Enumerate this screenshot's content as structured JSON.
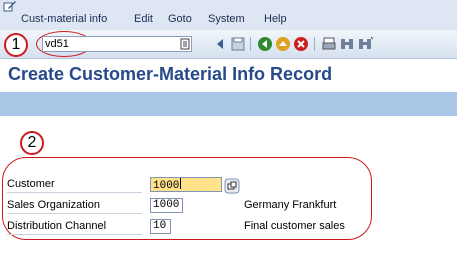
{
  "menu": {
    "items": [
      "Cust-material info",
      "Edit",
      "Goto",
      "System",
      "Help"
    ]
  },
  "toolbar": {
    "command_value": "vd51",
    "buttons": [
      "enter-icon",
      "save-icon",
      "back-icon",
      "exit-icon",
      "cancel-icon",
      "print-icon",
      "find-icon",
      "find-next-icon"
    ]
  },
  "annotations": {
    "step1": "1",
    "step2": "2"
  },
  "page": {
    "title": "Create Customer-Material Info Record"
  },
  "form": {
    "fields": [
      {
        "label": "Customer",
        "value": "1000",
        "description": ""
      },
      {
        "label": "Sales Organization",
        "value": "1000",
        "description": "Germany Frankfurt"
      },
      {
        "label": "Distribution Channel",
        "value": "10",
        "description": "Final customer sales"
      }
    ]
  },
  "colors": {
    "annotation": "#d0191e",
    "title": "#274a8a",
    "required_field": "#ffe28a",
    "app_toolbar": "#a9c6e6"
  }
}
